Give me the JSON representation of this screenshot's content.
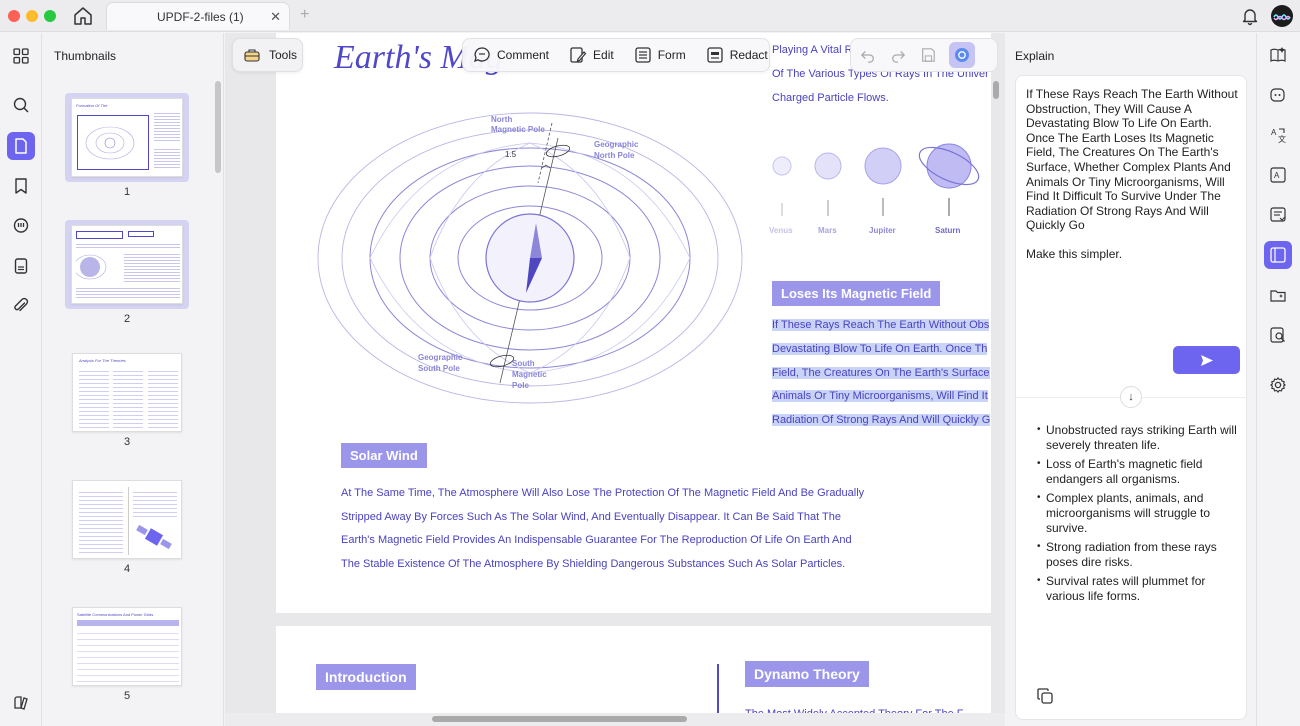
{
  "window": {
    "tab_title": "UPDF-2-files (1)",
    "tab_close": "✕",
    "tab_add": "+"
  },
  "left_rail": {
    "items": [
      "thumbnails-grid-icon",
      "search-icon",
      "pages-icon",
      "bookmark-icon",
      "comments-icon",
      "attachment-page-icon",
      "paperclip-icon",
      "layers-icon"
    ]
  },
  "thumbnails": {
    "title": "Thumbnails",
    "pages": [
      {
        "number": "1",
        "selected": true
      },
      {
        "number": "2",
        "selected": true
      },
      {
        "number": "3",
        "selected": false
      },
      {
        "number": "4",
        "selected": false
      },
      {
        "number": "5",
        "selected": false
      }
    ],
    "thumb_titles": {
      "p1": "Formation Of The",
      "p3": "Analysis For The Theories",
      "p5": "Satellite Communications And Power Grids"
    }
  },
  "toolbar": {
    "tools": "Tools",
    "comment": "Comment",
    "edit": "Edit",
    "form": "Form",
    "redact": "Redact"
  },
  "document": {
    "title": "Earth's Mag",
    "top_right_lines": [
      "Playing A Vital R",
      "Of The Various Types Of Rays In The Univer",
      "Charged Particle Flows."
    ],
    "diagram_labels": {
      "north_magnetic": "North\nMagnetic Pole",
      "geo_north_1": "Geographic",
      "geo_north_2": "North Pole",
      "geo_south_1": "Geographic",
      "geo_south_2": "South Pole",
      "south_mag_1": "South",
      "south_mag_2": "Magnetic",
      "south_mag_3": "Pole",
      "angle": "1.5"
    },
    "planets": [
      "Venus",
      "Mars",
      "Jupiter",
      "Saturn"
    ],
    "section_loses": "Loses Its Magnetic Field",
    "loses_lines": [
      "If These Rays Reach The Earth Without Obs",
      "Devastating Blow To Life On Earth. Once Th",
      "Field, The Creatures On The Earth's Surface",
      "Animals Or Tiny Microorganisms, Will Find It",
      "Radiation Of Strong Rays And Will Quickly G"
    ],
    "section_solar": "Solar Wind",
    "solar_lines": [
      "At The Same Time, The Atmosphere Will Also Lose The Protection Of The Magnetic Field And Be Gradually",
      "Stripped Away By Forces Such As The Solar Wind, And Eventually Disappear. It Can Be Said That The",
      "Earth's Magnetic Field Provides An Indispensable Guarantee For The Reproduction Of Life On Earth And",
      "The Stable Existence Of The Atmosphere By Shielding Dangerous Substances Such As Solar Particles."
    ],
    "section_intro": "Introduction",
    "section_dynamo": "Dynamo Theory",
    "dynamo_partial": "The Most Widely Accepted Theory For The F"
  },
  "explain": {
    "title": "Explain",
    "prompt": "If These Rays Reach The Earth Without Obstruction, They Will Cause A Devastating Blow To Life On Earth. Once The Earth Loses Its Magnetic Field, The Creatures On The Earth's Surface, Whether Complex Plants And Animals Or Tiny Microorganisms, Will Find It Difficult To Survive Under The Radiation Of Strong Rays And Will Quickly Go",
    "instruction": "Make this simpler.",
    "arrow": "↓",
    "bullets": [
      "Unobstructed rays striking Earth will severely threaten life.",
      "Loss of Earth's magnetic field endangers all organisms.",
      "Complex plants, animals, and microorganisms will struggle to survive.",
      "Strong radiation from these rays poses dire risks.",
      "Survival rates will plummet for various life forms."
    ]
  },
  "colors": {
    "accent": "#6d65f0",
    "doc_blue": "#4a42c0",
    "chip": "#9b96ea"
  }
}
